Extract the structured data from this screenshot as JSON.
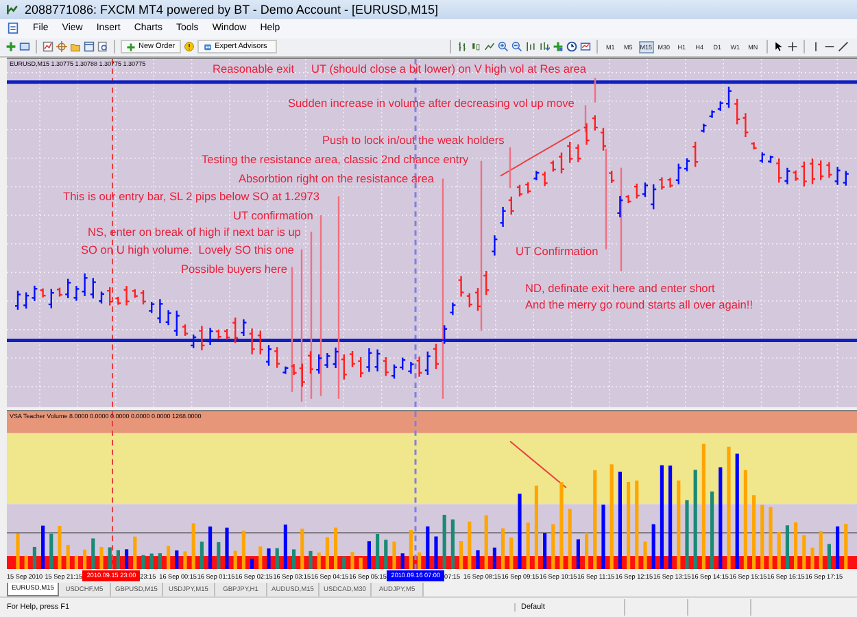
{
  "window": {
    "title": "2088771086: FXCM MT4 powered by BT - Demo Account - [EURUSD,M15]"
  },
  "menu": [
    "File",
    "View",
    "Insert",
    "Charts",
    "Tools",
    "Window",
    "Help"
  ],
  "toolbar": {
    "new_order": "New Order",
    "expert_advisors": "Expert Advisors",
    "timeframes": [
      {
        "label": "M1",
        "selected": false
      },
      {
        "label": "M5",
        "selected": false
      },
      {
        "label": "M15",
        "selected": true
      },
      {
        "label": "M30",
        "selected": false
      },
      {
        "label": "H1",
        "selected": false
      },
      {
        "label": "H4",
        "selected": false
      },
      {
        "label": "D1",
        "selected": false
      },
      {
        "label": "W1",
        "selected": false
      },
      {
        "label": "MN",
        "selected": false
      }
    ]
  },
  "chart": {
    "header": "EURUSD,M15  1.30775 1.30788 1.30775 1.30775",
    "annotations": [
      "Reasonable exit",
      "UT (should close a bit lower) on V high vol at Res area",
      "Sudden increase in volume after decreasing vol up move",
      "Push to lock in/out the weak holders",
      "Testing the resistance area, classic 2nd chance entry",
      "Absorbtion right on the resistance area",
      "This is our entry bar, SL 2 pips below SO at 1.2973",
      "UT confirmation",
      "NS, enter on break of high if next bar is up",
      "SO on U high volume.  Lovely SO this one",
      "Possible buyers here",
      "UT Confirmation",
      "ND, definate exit here and enter short",
      "And the merry go round starts all over again!!"
    ]
  },
  "indicator": {
    "header": "VSA Teacher Volume 8.0000 0.0000 0.0000 0.0000 0.0000 1268.0000"
  },
  "time_axis": [
    {
      "label": "15 Sep 2010",
      "kind": "label"
    },
    {
      "label": "15 Sep 21:15",
      "kind": "label"
    },
    {
      "label": "2010.09.15 23:00",
      "kind": "marker",
      "color": "#ff0000"
    },
    {
      "label": "23:15",
      "kind": "partial"
    },
    {
      "label": "16 Sep 00:15",
      "kind": "label"
    },
    {
      "label": "16 Sep 01:15",
      "kind": "label"
    },
    {
      "label": "16 Sep 02:15",
      "kind": "label"
    },
    {
      "label": "16 Sep 03:15",
      "kind": "label"
    },
    {
      "label": "16 Sep 04:15",
      "kind": "label"
    },
    {
      "label": "16 Sep 05:15",
      "kind": "label"
    },
    {
      "label": "2010.09.16 07:00",
      "kind": "marker",
      "color": "#0000ff"
    },
    {
      "label": "07:15",
      "kind": "partial"
    },
    {
      "label": "16 Sep 08:15",
      "kind": "label"
    },
    {
      "label": "16 Sep 09:15",
      "kind": "label"
    },
    {
      "label": "16 Sep 10:15",
      "kind": "label"
    },
    {
      "label": "16 Sep 11:15",
      "kind": "label"
    },
    {
      "label": "16 Sep 12:15",
      "kind": "label"
    },
    {
      "label": "16 Sep 13:15",
      "kind": "label"
    },
    {
      "label": "16 Sep 14:15",
      "kind": "label"
    },
    {
      "label": "16 Sep 15:15",
      "kind": "label"
    },
    {
      "label": "16 Sep 16:15",
      "kind": "label"
    },
    {
      "label": "16 Sep 17:15",
      "kind": "label"
    }
  ],
  "tabs": [
    {
      "label": "EURUSD,M15",
      "selected": true
    },
    {
      "label": "USDCHF,M5",
      "selected": false
    },
    {
      "label": "GBPUSD,M15",
      "selected": false
    },
    {
      "label": "USDJPY,M15",
      "selected": false
    },
    {
      "label": "GBPJPY,H1",
      "selected": false
    },
    {
      "label": "AUDUSD,M15",
      "selected": false
    },
    {
      "label": "USDCAD,M30",
      "selected": false
    },
    {
      "label": "AUDJPY,M5",
      "selected": false
    }
  ],
  "status_bar": {
    "help": "For Help, press F1",
    "profile": "Default"
  }
}
